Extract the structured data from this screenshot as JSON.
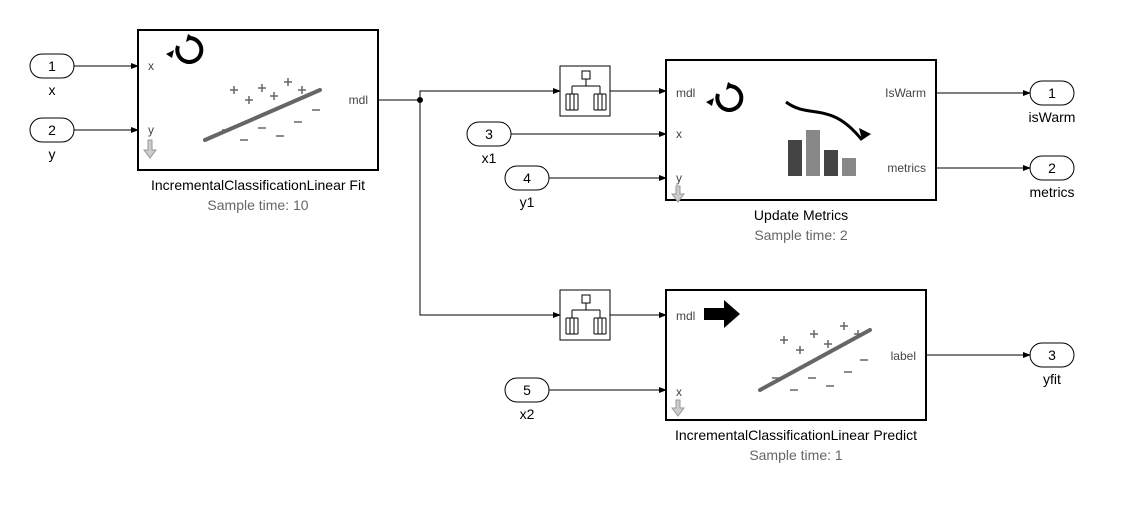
{
  "inports": {
    "p1": {
      "num": "1",
      "label": "x"
    },
    "p2": {
      "num": "2",
      "label": "y"
    },
    "p3": {
      "num": "3",
      "label": "x1"
    },
    "p4": {
      "num": "4",
      "label": "y1"
    },
    "p5": {
      "num": "5",
      "label": "x2"
    }
  },
  "outports": {
    "o1": {
      "num": "1",
      "label": "isWarm"
    },
    "o2": {
      "num": "2",
      "label": "metrics"
    },
    "o3": {
      "num": "3",
      "label": "yfit"
    }
  },
  "fit": {
    "name": "IncrementalClassificationLinear Fit",
    "sample": "Sample time: 10",
    "port_x": "x",
    "port_y": "y",
    "port_mdl": "mdl"
  },
  "update": {
    "name": "Update Metrics",
    "sample": "Sample time: 2",
    "port_mdl": "mdl",
    "port_x": "x",
    "port_y": "y",
    "port_isWarm": "IsWarm",
    "port_metrics": "metrics"
  },
  "predict": {
    "name": "IncrementalClassificationLinear Predict",
    "sample": "Sample time: 1",
    "port_mdl": "mdl",
    "port_x": "x",
    "port_label": "label"
  }
}
